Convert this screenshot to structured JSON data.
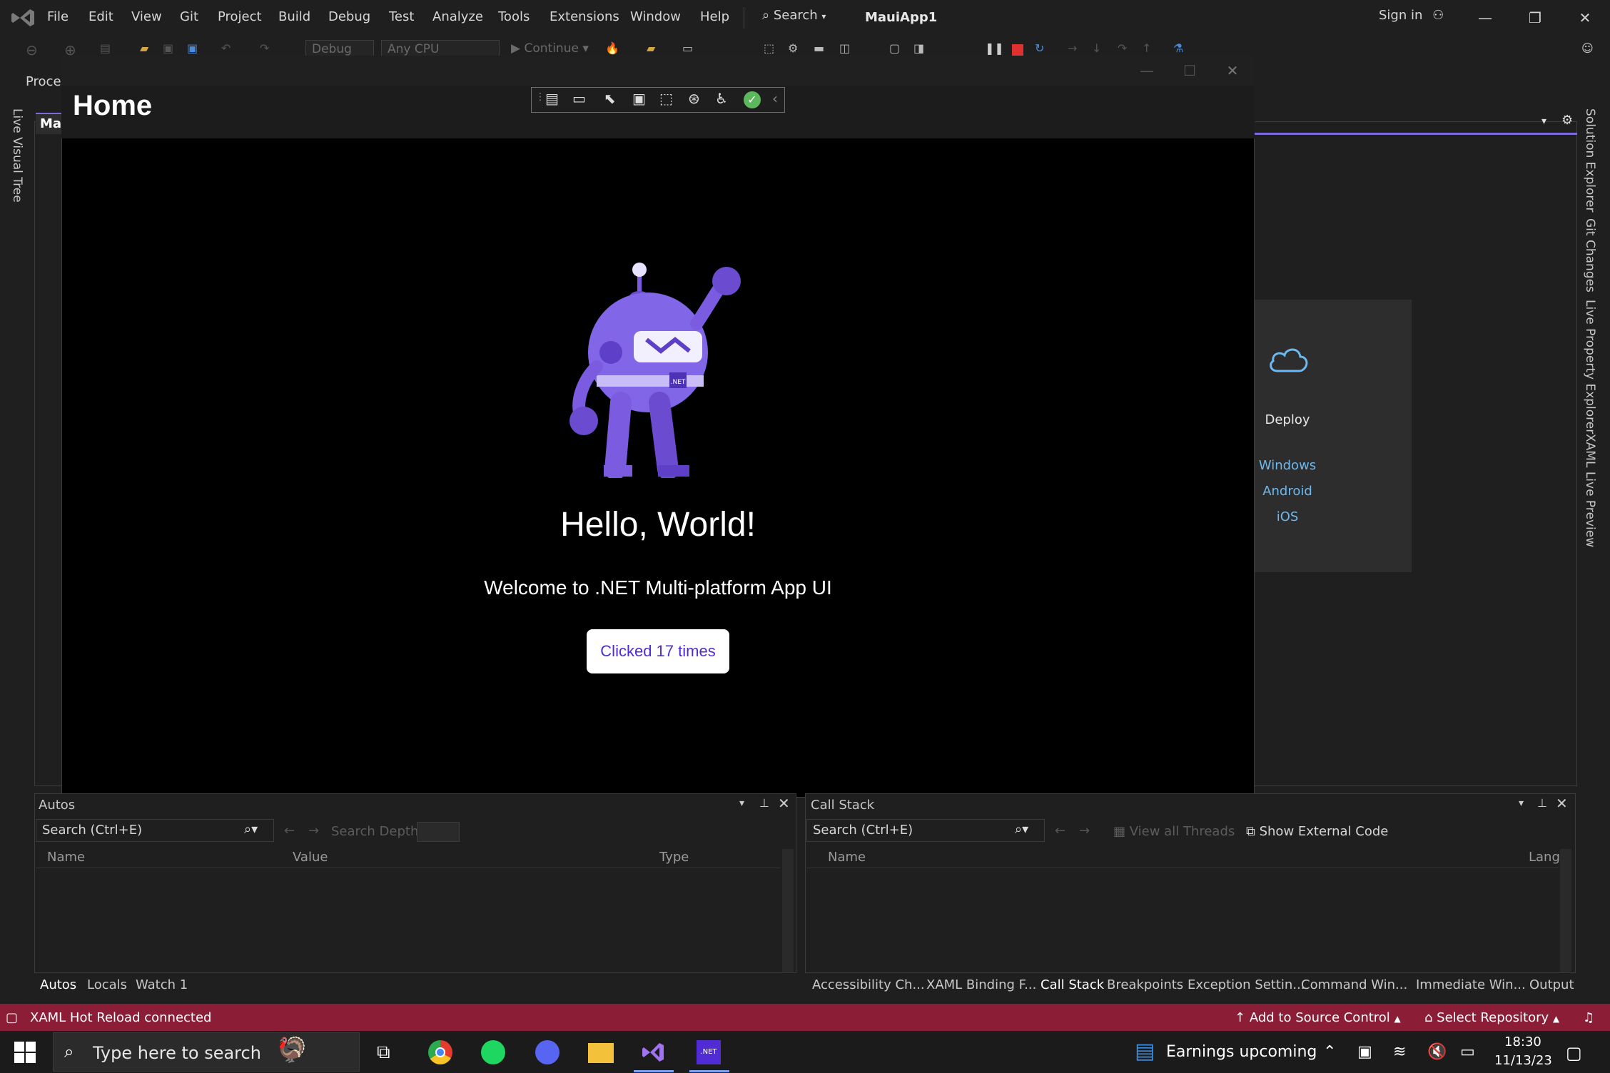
{
  "menubar": {
    "items": [
      "File",
      "Edit",
      "View",
      "Git",
      "Project",
      "Build",
      "Debug",
      "Test",
      "Analyze",
      "Tools",
      "Extensions",
      "Window",
      "Help"
    ],
    "search_label": "Search",
    "project_name": "MauiApp1",
    "signin_label": "Sign in"
  },
  "toolbar": {
    "config": "Debug",
    "platform": "Any CPU",
    "continue_label": "Continue"
  },
  "left_tabs": {
    "process_label": "Proces",
    "live_visual_tree": "Live Visual Tree"
  },
  "document": {
    "tab_label": "Mau"
  },
  "right_tabs": [
    "Solution Explorer",
    "Git Changes",
    "Live Property Explorer",
    "XAML Live Preview"
  ],
  "deploy": {
    "title": "Deploy",
    "targets": [
      "Windows",
      "Android",
      "iOS"
    ]
  },
  "app": {
    "header_title": "Home",
    "hello": "Hello, World!",
    "welcome": "Welcome to .NET Multi-platform App UI",
    "button_label": "Clicked 17 times",
    "bot_badge": ".NET"
  },
  "autos": {
    "title": "Autos",
    "search_placeholder": "Search (Ctrl+E)",
    "search_depth_label": "Search Depth:",
    "columns": [
      "Name",
      "Value",
      "Type"
    ],
    "tabs": [
      "Autos",
      "Locals",
      "Watch 1"
    ]
  },
  "callstack": {
    "title": "Call Stack",
    "search_placeholder": "Search (Ctrl+E)",
    "view_all_threads": "View all Threads",
    "show_external_code": "Show External Code",
    "columns": [
      "Name",
      "Lang"
    ],
    "tabs": [
      "Accessibility Ch...",
      "XAML Binding F...",
      "Call Stack",
      "Breakpoints",
      "Exception Settin...",
      "Command Win...",
      "Immediate Win...",
      "Output"
    ]
  },
  "statusbar": {
    "hot_reload": "XAML Hot Reload connected",
    "add_source_control": "Add to Source Control",
    "select_repository": "Select Repository"
  },
  "taskbar": {
    "search_placeholder": "Type here to search",
    "news_label": "Earnings upcoming",
    "time": "18:30",
    "date": "11/13/23",
    "net_badge": ".NET"
  },
  "colors": {
    "accent": "#7a6bd8",
    "statusbar": "#8b1d37",
    "dotnet_purple": "#512bd4",
    "link_blue": "#6cb8f0"
  }
}
